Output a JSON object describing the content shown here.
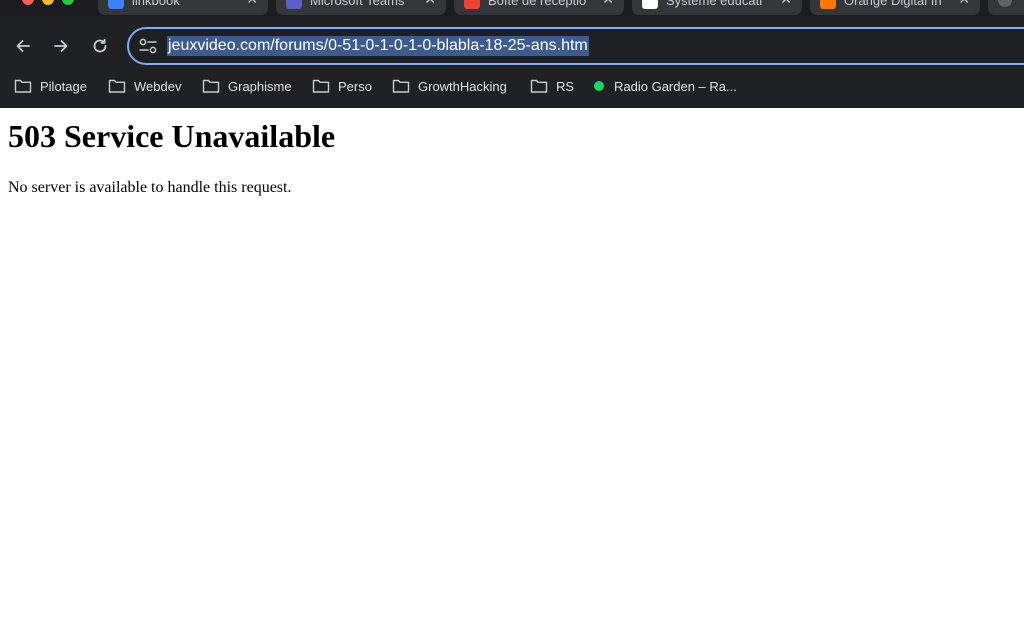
{
  "browser": {
    "tabs": [
      {
        "title": "linkbook",
        "close": "✕",
        "favicon_color": "#3b82f6"
      },
      {
        "title": "Microsoft Teams",
        "close": "✕",
        "favicon_color": "#5b5fc7"
      },
      {
        "title": "Boîte de réceptio",
        "close": "✕",
        "favicon_color": "#ea4335"
      },
      {
        "title": "Système éducati",
        "close": "✕",
        "favicon_color": "#ffffff"
      },
      {
        "title": "Orange Digital In",
        "close": "✕",
        "favicon_color": "#ff7900"
      }
    ],
    "url": "jeuxvideo.com/forums/0-51-0-1-0-1-0-blabla-18-25-ans.htm",
    "bookmarks": [
      {
        "label": "Pilotage",
        "icon": "folder-icon"
      },
      {
        "label": "Webdev",
        "icon": "folder-icon"
      },
      {
        "label": "Graphisme",
        "icon": "folder-icon"
      },
      {
        "label": "Perso",
        "icon": "folder-icon"
      },
      {
        "label": "GrowthHacking",
        "icon": "folder-icon"
      },
      {
        "label": "RS",
        "icon": "folder-icon"
      },
      {
        "label": "Radio Garden – Ra...",
        "icon": "radio-dot-icon"
      }
    ]
  },
  "page": {
    "heading": "503 Service Unavailable",
    "message": "No server is available to handle this request."
  },
  "colors": {
    "chrome_bg": "#202124",
    "omnibox_border": "#7cacf8",
    "url_selection": "#3c5b8f"
  }
}
